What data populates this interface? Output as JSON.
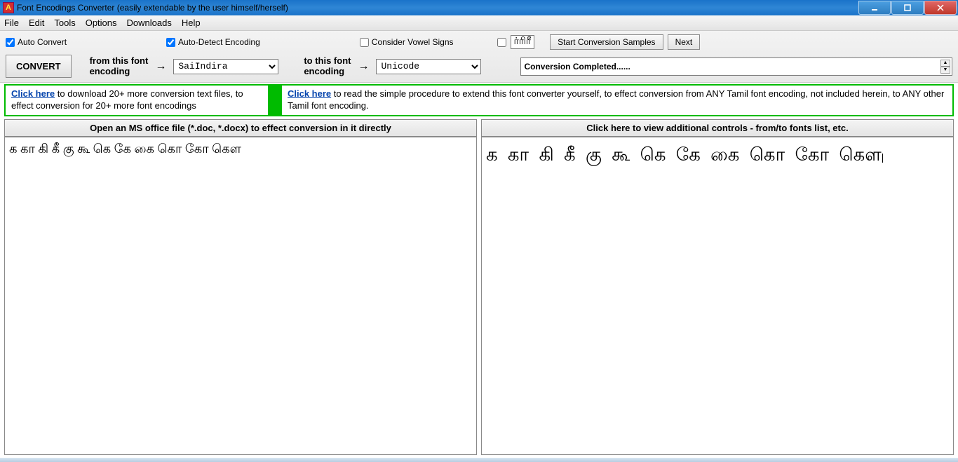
{
  "window": {
    "title": "Font Encodings Converter (easily extendable by the user himself/herself)"
  },
  "menu": {
    "file": "File",
    "edit": "Edit",
    "tools": "Tools",
    "options": "Options",
    "downloads": "Downloads",
    "help": "Help"
  },
  "toolbar": {
    "auto_convert": "Auto Convert",
    "auto_detect": "Auto-Detect Encoding",
    "consider_vowel": "Consider Vowel Signs",
    "sample_glyph": "ர்ரிரீ",
    "start_samples": "Start Conversion Samples",
    "next": "Next",
    "convert": "CONVERT",
    "from_label_1": "from this font",
    "from_label_2": "encoding",
    "to_label_1": "to this font",
    "to_label_2": "encoding",
    "from_value": "SaiIndira",
    "to_value": "Unicode",
    "status": "Conversion Completed......"
  },
  "info": {
    "left_link": "Click here",
    "left_text": " to download 20+ more conversion text files, to effect conversion for 20+ more font encodings",
    "right_link": "Click here",
    "right_text": " to read the simple procedure to extend this font converter yourself, to effect conversion from ANY Tamil font encoding, not included herein, to ANY other Tamil font encoding."
  },
  "panes": {
    "left_header": "Open an MS office file (*.doc, *.docx) to effect conversion in it directly",
    "right_header": "Click here to view additional controls - from/to fonts list, etc.",
    "left_content": "க கா கி கீ கு கூ கெ கே கை  கொ கோ கௌ",
    "right_content": "க கா கி கீ கு கூ கெ கே கை  கொ கோ கௌ"
  }
}
